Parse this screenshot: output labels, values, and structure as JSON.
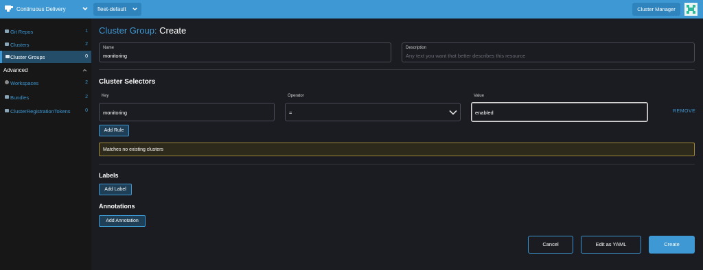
{
  "header": {
    "app_title": "Continuous Delivery",
    "namespace": "fleet-default",
    "cluster_manager": "Cluster Manager"
  },
  "sidebar": {
    "items": [
      {
        "label": "Git Repos",
        "count": "1"
      },
      {
        "label": "Clusters",
        "count": "2"
      },
      {
        "label": "Cluster Groups",
        "count": "0"
      }
    ],
    "advanced_label": "Advanced",
    "advanced_items": [
      {
        "label": "Workspaces",
        "count": "2"
      },
      {
        "label": "Bundles",
        "count": "2"
      },
      {
        "label": "ClusterRegistrationTokens",
        "count": "0"
      }
    ]
  },
  "page": {
    "title_prefix": "Cluster Group:",
    "title_action": "Create",
    "name_label": "Name",
    "name_value": "monitoring",
    "description_label": "Description",
    "description_placeholder": "Any text you want that better describes this resource"
  },
  "selectors": {
    "title": "Cluster Selectors",
    "key_label": "Key",
    "operator_label": "Operator",
    "value_label": "Value",
    "key_value": "monitoring",
    "operator_value": "=",
    "value_value": "enabled",
    "remove_label": "REMOVE",
    "add_rule_label": "Add Rule",
    "banner_text": "Matches no existing clusters"
  },
  "labels": {
    "title": "Labels",
    "add_label": "Add Label"
  },
  "annotations": {
    "title": "Annotations",
    "add_label": "Add Annotation"
  },
  "footer": {
    "cancel": "Cancel",
    "edit_yaml": "Edit as YAML",
    "create": "Create"
  },
  "colors": {
    "accent": "#3d98d3",
    "sidebar_bg": "#171717",
    "main_bg": "#1b1c21",
    "warning_border": "#a08a3a"
  }
}
